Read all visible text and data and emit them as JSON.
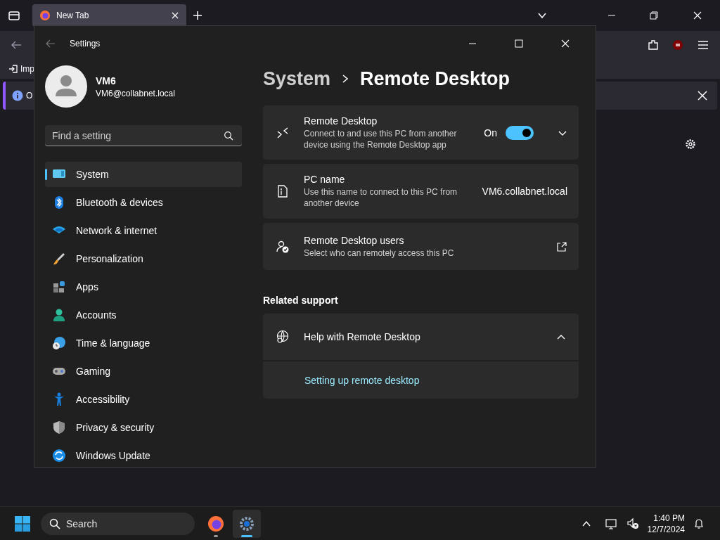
{
  "browser": {
    "tab": {
      "title": "New Tab",
      "selected": true
    },
    "bookmark": "Imp",
    "notice": "O"
  },
  "settings": {
    "title": "Settings",
    "user": {
      "name": "VM6",
      "email": "VM6@collabnet.local"
    },
    "search": {
      "placeholder": "Find a setting"
    },
    "nav": [
      {
        "label": "System",
        "selected": true
      },
      {
        "label": "Bluetooth & devices",
        "selected": false
      },
      {
        "label": "Network & internet",
        "selected": false
      },
      {
        "label": "Personalization",
        "selected": false
      },
      {
        "label": "Apps",
        "selected": false
      },
      {
        "label": "Accounts",
        "selected": false
      },
      {
        "label": "Time & language",
        "selected": false
      },
      {
        "label": "Gaming",
        "selected": false
      },
      {
        "label": "Accessibility",
        "selected": false
      },
      {
        "label": "Privacy & security",
        "selected": false
      },
      {
        "label": "Windows Update",
        "selected": false
      }
    ],
    "breadcrumb": [
      "System",
      "Remote Desktop"
    ],
    "cards": [
      {
        "kind": "toggle",
        "title": "Remote Desktop",
        "description": "Connect to and use this PC from another device using the Remote Desktop app",
        "state_label": "On",
        "on": true,
        "expanded": false
      },
      {
        "kind": "value",
        "title": "PC name",
        "description": "Use this name to connect to this PC from another device",
        "value": "VM6.collabnet.local"
      },
      {
        "kind": "link",
        "title": "Remote Desktop users",
        "description": "Select who can remotely access this PC"
      }
    ],
    "related": {
      "heading": "Related support",
      "group": {
        "title": "Help with Remote Desktop",
        "expanded": true,
        "links": [
          "Setting up remote desktop"
        ]
      }
    }
  },
  "taskbar": {
    "search": {
      "placeholder": "Search"
    },
    "apps": [
      {
        "selected": false
      },
      {
        "selected": true
      }
    ],
    "time": "1:40 PM",
    "date": "12/7/2024"
  }
}
